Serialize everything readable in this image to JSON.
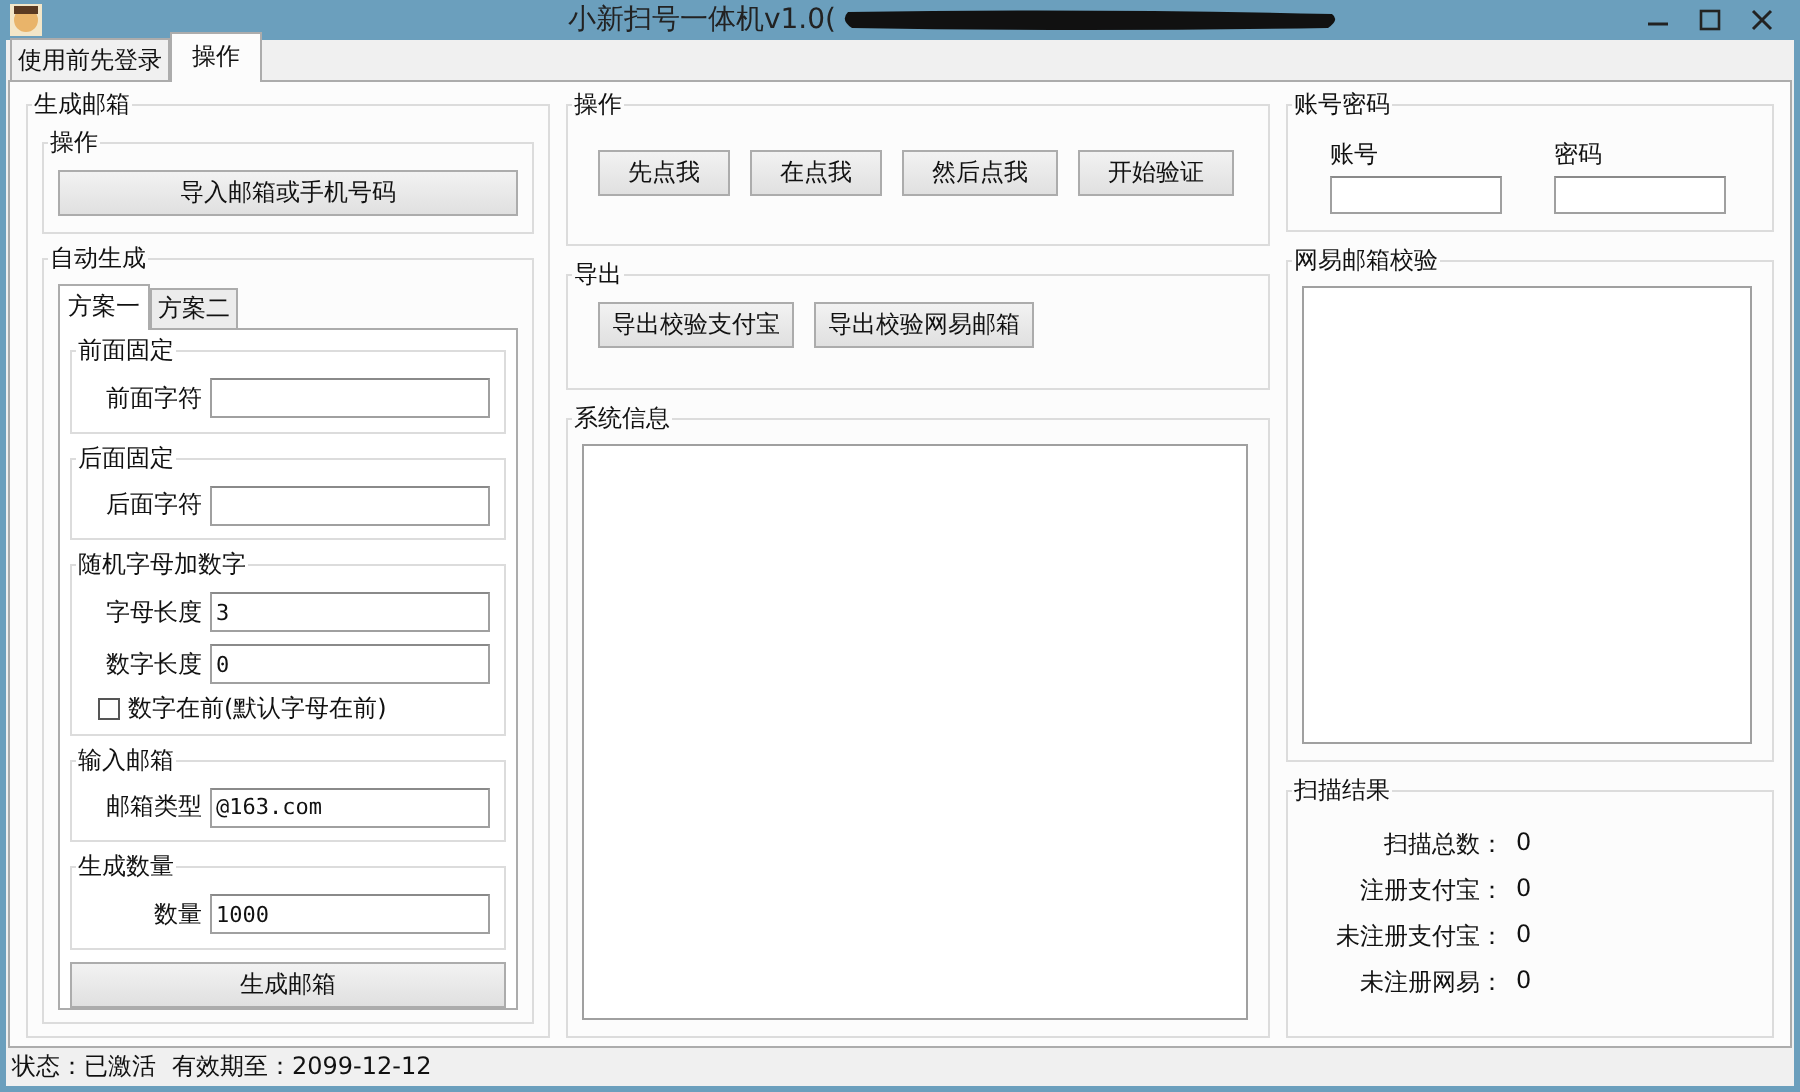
{
  "window": {
    "title": "小新扫号一体机v1.0("
  },
  "tabs": [
    {
      "label": "使用前先登录",
      "selected": false
    },
    {
      "label": "操作",
      "selected": true
    }
  ],
  "generate_panel": {
    "title": "生成邮箱",
    "operation": {
      "title": "操作",
      "import_button": "导入邮箱或手机号码"
    },
    "auto": {
      "title": "自动生成",
      "tabs": [
        {
          "label": "方案一",
          "selected": true
        },
        {
          "label": "方案二",
          "selected": false
        }
      ],
      "sections": [
        {
          "title": "前面固定",
          "fields": [
            {
              "label": "前面字符"
            }
          ]
        },
        {
          "title": "后面固定",
          "fields": [
            {
              "label": "后面字符"
            }
          ]
        },
        {
          "title": "随机字母加数字",
          "fields": [
            {
              "label": "字母长度",
              "value": "3"
            },
            {
              "label": "数字长度",
              "value": "0"
            }
          ],
          "checkbox": {
            "label": "数字在前(默认字母在前)",
            "checked": false
          }
        },
        {
          "title": "输入邮箱",
          "fields": [
            {
              "label": "邮箱类型",
              "value": "@163.com"
            }
          ]
        },
        {
          "title": "生成数量",
          "fields": [
            {
              "label": "数量",
              "value": "1000"
            }
          ]
        }
      ],
      "generate_button": "生成邮箱"
    }
  },
  "operation": {
    "title": "操作",
    "buttons": [
      "先点我",
      "在点我",
      "然后点我",
      "开始验证"
    ]
  },
  "export": {
    "title": "导出",
    "buttons": [
      "导出校验支付宝",
      "导出校验网易邮箱"
    ]
  },
  "system_info": {
    "title": "系统信息"
  },
  "account": {
    "title": "账号密码",
    "fields": [
      {
        "label": "账号"
      },
      {
        "label": "密码"
      }
    ]
  },
  "netease_check": {
    "title": "网易邮箱校验"
  },
  "scan_results": {
    "title": "扫描结果",
    "rows": [
      {
        "label": "扫描总数：",
        "value": "0"
      },
      {
        "label": "注册支付宝：",
        "value": "0"
      },
      {
        "label": "未注册支付宝：",
        "value": "0"
      },
      {
        "label": "未注册网易：",
        "value": "0"
      }
    ]
  },
  "status_bar": {
    "items": [
      "状态：已激活",
      "有效期至：2099-12-12"
    ]
  }
}
